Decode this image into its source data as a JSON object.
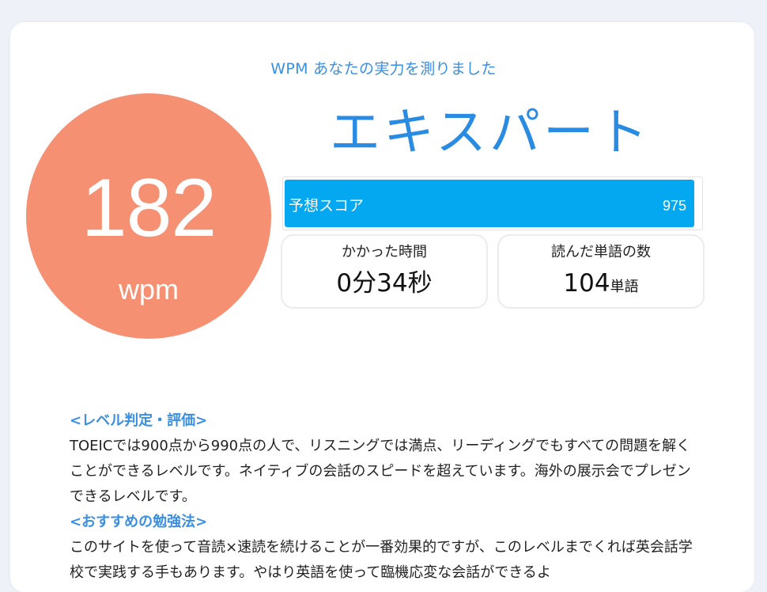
{
  "header": {
    "subtitle": "WPM あなたの実力を測りました"
  },
  "speed": {
    "value": "182",
    "unit": "wpm",
    "circle_color": "#f69073"
  },
  "level": {
    "title": "エキスパート"
  },
  "score": {
    "label": "予想スコア",
    "value": "975",
    "max": 990,
    "fill_fraction": 0.985,
    "bar_color": "#03a8f0"
  },
  "stats": {
    "time": {
      "label": "かかった時間",
      "value": "0分34秒"
    },
    "words": {
      "label": "読んだ単語の数",
      "value": "104",
      "unit": "単語"
    }
  },
  "content": {
    "evaluation_heading": "<レベル判定・評価>",
    "evaluation_text": "TOEICでは900点から990点の人で、リスニングでは満点、リーディングでもすべての問題を解くことができるレベルです。ネイティブの会話のスピードを超えています。海外の展示会でプレゼンできるレベルです。",
    "study_heading": "<おすすめの勉強法>",
    "study_text": "このサイトを使って音読×速読を続けることが一番効果的ですが、このレベルまでくれば英会話学校で実践する手もあります。やはり英語を使って臨機応変な会話ができるよ"
  },
  "colors": {
    "accent_blue": "#2a8be3",
    "background": "#eef2f8"
  }
}
